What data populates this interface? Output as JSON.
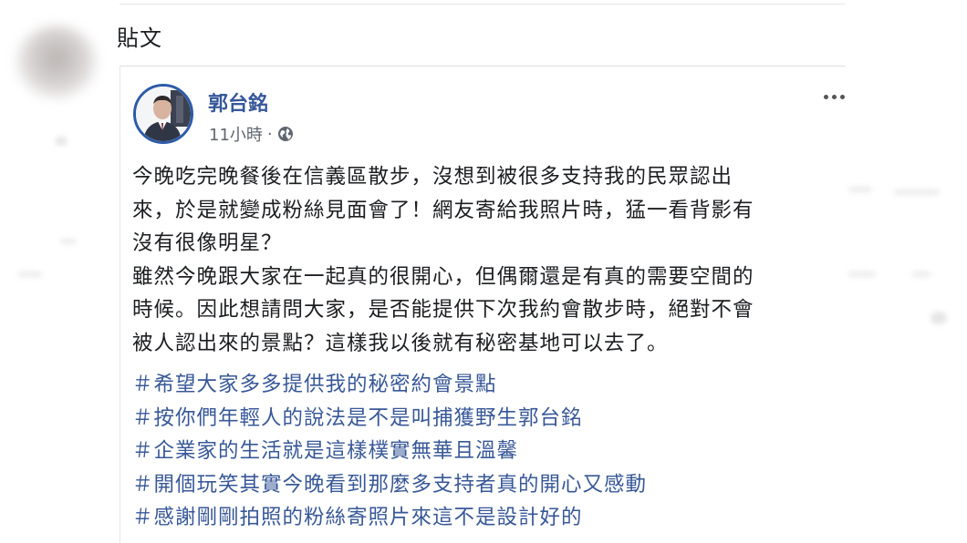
{
  "section_title": "貼文",
  "post": {
    "author": "郭台銘",
    "time": "11小時",
    "separator": "·",
    "privacy_icon": "globe-icon",
    "more_icon": "more-options-icon",
    "body_lines": [
      "今晚吃完晚餐後在信義區散步，沒想到被很多支持我的民眾認出",
      "來，於是就變成粉絲見面會了！網友寄給我照片時，猛一看背影有",
      "沒有很像明星？",
      "雖然今晚跟大家在一起真的很開心，但偶爾還是有真的需要空間的",
      "時候。因此想請問大家，是否能提供下次我約會散步時，絕對不會",
      "被人認出來的景點？這樣我以後就有秘密基地可以去了。"
    ],
    "hashtags": [
      "＃希望大家多多提供我的秘密約會景點",
      "＃按你們年輕人的說法是不是叫捕獲野生郭台銘",
      "＃企業家的生活就是這樣樸實無華且溫馨",
      "＃開個玩笑其實今晚看到那麼多支持者真的開心又感動",
      "＃感謝剛剛拍照的粉絲寄照片來這不是設計好的"
    ]
  },
  "colors": {
    "author": "#365899",
    "hashtag": "#385898",
    "meta": "#616770",
    "avatar_ring": "#2d5ba8"
  }
}
